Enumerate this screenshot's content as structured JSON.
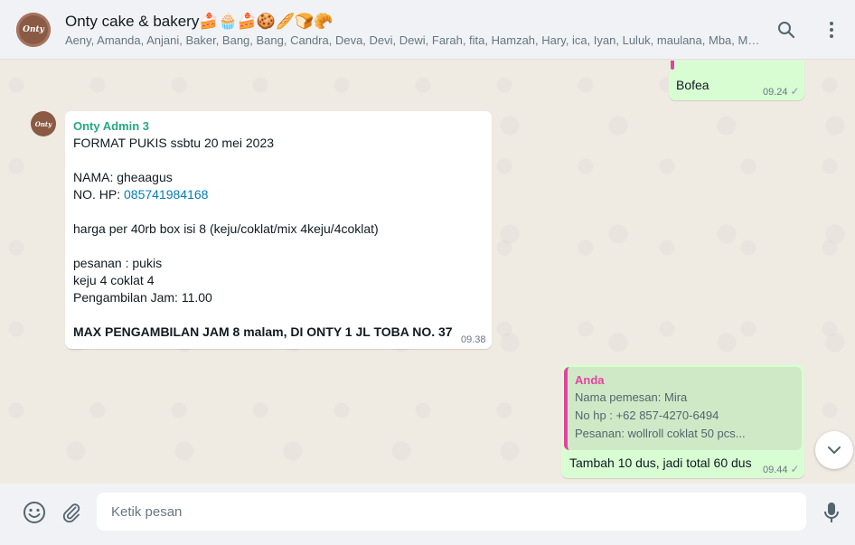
{
  "header": {
    "avatar_text": "Onty",
    "title": "Onty cake & bakery🍰🧁🍰🍪🥖🍞🥐",
    "subtitle": "Aeny, Amanda, Anjani, Baker, Bang, Bang, Candra, Deva, Devi, Dewi, Farah, fita, Hamzah, Hary, ica, Iyan, Luluk, maulana, Mba, Mida,..."
  },
  "messages": {
    "top_out": {
      "text": "Bofea",
      "time": "09.24",
      "check": "✓"
    },
    "incoming": {
      "avatar_text": "Onty",
      "sender": "Onty Admin 3",
      "line1": "FORMAT PUKIS  ssbtu 20 mei 2023",
      "line2": "NAMA: gheaagus",
      "line3_label": "NO. HP:  ",
      "line3_phone": "085741984168",
      "line4": "harga per 40rb box isi 8 (keju/coklat/mix 4keju/4coklat)",
      "line5": "pesanan :  pukis",
      "line6": "keju 4 coklat 4",
      "line7": "Pengambilan Jam: 11.00",
      "line8": "MAX PENGAMBILAN JAM 8 malam, DI ONTY 1 JL TOBA NO. 37",
      "time": "09.38"
    },
    "reply_out": {
      "quote_author": "Anda",
      "quote_line1": "Nama pemesan: Mira",
      "quote_line2": "No hp : +62 857-4270-6494",
      "quote_line3": "Pesanan: wollroll coklat 50 pcs...",
      "text": "Tambah 10 dus, jadi total 60 dus",
      "time": "09.44",
      "check": "✓"
    }
  },
  "composer": {
    "placeholder": "Ketik pesan"
  },
  "colors": {
    "accent_green": "#25a884",
    "quote_pink": "#e542a3",
    "outgoing_bubble": "#d9fdd3"
  },
  "icons": [
    "search-icon",
    "menu-dots-icon",
    "emoji-icon",
    "attach-icon",
    "mic-icon",
    "chevron-down-icon"
  ]
}
